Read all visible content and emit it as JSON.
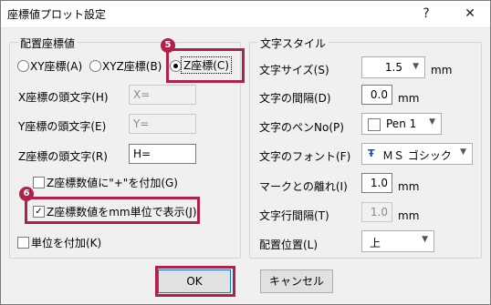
{
  "window": {
    "title": "座標値プロット設定",
    "help": "?",
    "close": "✕"
  },
  "left_group": {
    "title": "配置座標値",
    "radio_xy": "XY座標(A)",
    "radio_xyz": "XYZ座標(B)",
    "radio_z": "Z座標(C)",
    "x_prefix_label": "X座標の頭文字(H)",
    "x_prefix_value": "X=",
    "y_prefix_label": "Y座標の頭文字(E)",
    "y_prefix_value": "Y=",
    "z_prefix_label": "Z座標の頭文字(R)",
    "z_prefix_value": "H=",
    "plus_check": "Z座標数値に\"+\"を付加(G)",
    "mm_check": "Z座標数値をmm単位で表示(J)",
    "unit_check": "単位を付加(K)"
  },
  "right_group": {
    "title": "文字スタイル",
    "size_label": "文字サイズ(S)",
    "size_value": "1.5",
    "size_unit": "mm",
    "spacing_label": "文字の間隔(D)",
    "spacing_value": "0.0",
    "spacing_unit": "mm",
    "pen_label": "文字のペンNo(P)",
    "pen_value": "Pen 1",
    "font_label": "文字のフォント(F)",
    "font_value": "ＭＳ ゴシック",
    "gap_label": "マークとの離れ(I)",
    "gap_value": "1.0",
    "gap_unit": "mm",
    "line_spacing_label": "文字行間隔(T)",
    "line_spacing_value": "1.0",
    "line_spacing_unit": "mm",
    "position_label": "配置位置(L)",
    "position_value": "上"
  },
  "buttons": {
    "ok": "OK",
    "cancel": "キャンセル"
  },
  "callouts": {
    "badge_5": "5",
    "badge_6": "6",
    "color": "#b0214a"
  },
  "icons": {
    "font_icon": "Ŧ",
    "dropdown": "▼"
  }
}
